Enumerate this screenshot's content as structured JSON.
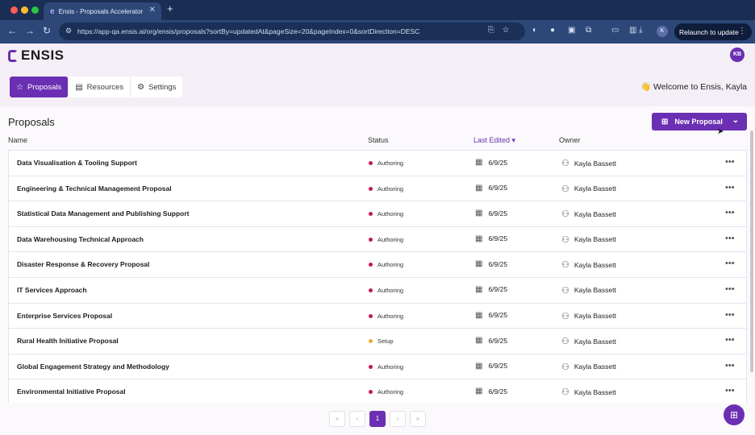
{
  "browser": {
    "tab_title": "Ensis - Proposals Accelerator",
    "tab_close": "✕",
    "new_tab": "+",
    "url": "https://app-qa.ensis.ai/org/ensis/proposals?sortBy=updatedAt&pageSize=20&pageIndex=0&sortDirection=DESC",
    "profile_initial": "K",
    "relaunch_label": "Relaunch to update",
    "icons": [
      "back-icon",
      "forward-icon",
      "reload-icon",
      "site-info-icon",
      "install-icon",
      "bookmark-star-icon",
      "extension-icon",
      "download-icon",
      "menu-icon"
    ]
  },
  "app": {
    "logo_text": "ENSIS",
    "user_initials": "KB",
    "nav_tabs": [
      {
        "label": "Proposals",
        "icon": "star-icon",
        "active": true
      },
      {
        "label": "Resources",
        "icon": "archive-box-icon",
        "active": false
      },
      {
        "label": "Settings",
        "icon": "gear-icon",
        "active": false
      }
    ],
    "welcome": "👋 Welcome to Ensis, Kayla",
    "page_title": "Proposals",
    "new_proposal_label": "New Proposal",
    "columns": {
      "name": "Name",
      "status": "Status",
      "last_edited": "Last Edited",
      "owner": "Owner"
    },
    "status_colors": {
      "Authoring": "#c2185b",
      "Setup": "#f0a73a"
    },
    "rows": [
      {
        "name": "Data Visualisation & Tooling Support",
        "status": "Authoring",
        "date": "6/9/25",
        "owner": "Kayla Bassett"
      },
      {
        "name": "Engineering & Technical Management Proposal",
        "status": "Authoring",
        "date": "6/9/25",
        "owner": "Kayla Bassett"
      },
      {
        "name": "Statistical Data Management and Publishing Support",
        "status": "Authoring",
        "date": "6/9/25",
        "owner": "Kayla Bassett"
      },
      {
        "name": "Data Warehousing Technical Approach",
        "status": "Authoring",
        "date": "6/9/25",
        "owner": "Kayla Bassett"
      },
      {
        "name": "Disaster Response & Recovery Proposal",
        "status": "Authoring",
        "date": "6/9/25",
        "owner": "Kayla Bassett"
      },
      {
        "name": "IT Services Approach",
        "status": "Authoring",
        "date": "6/9/25",
        "owner": "Kayla Bassett"
      },
      {
        "name": "Enterprise Services Proposal",
        "status": "Authoring",
        "date": "6/9/25",
        "owner": "Kayla Bassett"
      },
      {
        "name": "Rural Health Initiative Proposal",
        "status": "Setup",
        "date": "6/9/25",
        "owner": "Kayla Bassett"
      },
      {
        "name": "Global Engagement Strategy and Methodology",
        "status": "Authoring",
        "date": "6/9/25",
        "owner": "Kayla Bassett"
      },
      {
        "name": "Environmental Initiative Proposal",
        "status": "Authoring",
        "date": "6/9/25",
        "owner": "Kayla Bassett"
      }
    ],
    "pagination": {
      "first": "«",
      "prev": "‹",
      "current_page": "1",
      "next": "›",
      "last": "»"
    },
    "accent_color": "#6b2fb3"
  }
}
